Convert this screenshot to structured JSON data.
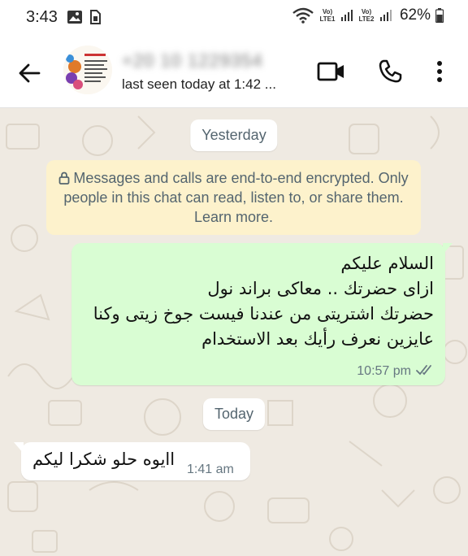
{
  "status_bar": {
    "time": "3:43",
    "sim1_label": "Vo) LTE1",
    "sim2_label": "Vo) LTE2",
    "battery": "62%"
  },
  "header": {
    "contact_name": "+20 10 1229354",
    "last_seen": "last seen today at 1:42 ..."
  },
  "chat": {
    "date_yesterday": "Yesterday",
    "encryption_notice": "Messages and calls are end-to-end encrypted. Only people in this chat can read, listen to, or share them. Learn more.",
    "outgoing": {
      "lines": [
        "السلام عليكم",
        "ازاى حضرتك .. معاكى براند نول",
        "حضرتك اشتريتى من عندنا فيست جوخ زيتى وكنا",
        "عايزين نعرف رأيك بعد الاستخدام"
      ],
      "time": "10:57 pm",
      "status": "read"
    },
    "date_today": "Today",
    "incoming": {
      "text": "اايوه حلو شكرا ليكم",
      "time": "1:41 am"
    }
  },
  "colors": {
    "outgoing_bubble": "#d9fdd3",
    "incoming_bubble": "#ffffff",
    "encryption_bg": "#fdf2cc",
    "chat_bg": "#efeae2"
  }
}
